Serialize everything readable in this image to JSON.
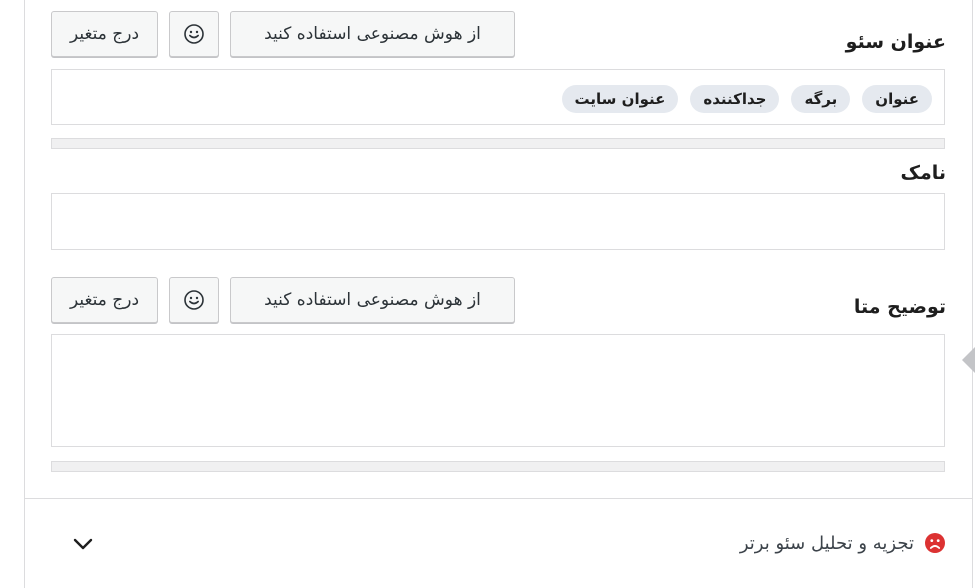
{
  "seo_title": {
    "label": "عنوان سئو",
    "ai_button": "از هوش مصنوعی استفاده کنید",
    "emoji_icon": "smiley-face-icon",
    "insert_variable_button": "درج متغیر",
    "tags": [
      "عنوان",
      "برگه",
      "جداکننده",
      "عنوان سایت"
    ]
  },
  "slug": {
    "label": "نامک",
    "value": ""
  },
  "meta_description": {
    "label": "توضیح متا",
    "ai_button": "از هوش مصنوعی استفاده کنید",
    "emoji_icon": "smiley-face-icon",
    "insert_variable_button": "درج متغیر",
    "value": ""
  },
  "analysis": {
    "label": "تجزیه و تحلیل سئو برتر",
    "status_icon": "sad-face-icon",
    "status_color": "#dc3232",
    "toggle_icon": "chevron-down-icon"
  }
}
